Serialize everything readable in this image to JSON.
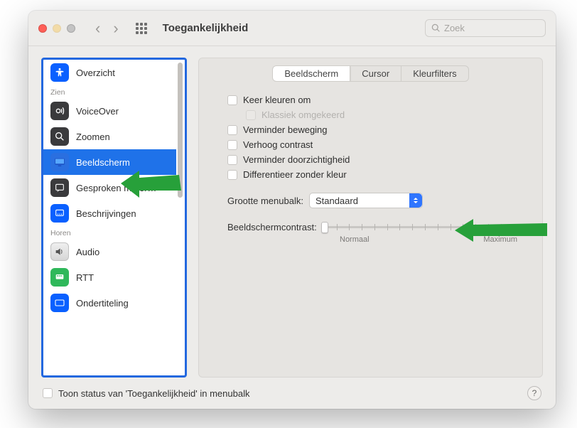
{
  "titlebar": {
    "title": "Toegankelijkheid",
    "search_placeholder": "Zoek"
  },
  "sidebar": {
    "overview_label": "Overzicht",
    "section_zien": "Zien",
    "section_horen": "Horen",
    "items": {
      "voiceover": "VoiceOver",
      "zoomen": "Zoomen",
      "beeldscherm": "Beeldscherm",
      "gesproken": "Gesproken mater…",
      "beschrijvingen": "Beschrijvingen",
      "audio": "Audio",
      "rtt": "RTT",
      "ondertiteling": "Ondertiteling"
    }
  },
  "tabs": {
    "beeldscherm": "Beeldscherm",
    "cursor": "Cursor",
    "kleurfilters": "Kleurfilters"
  },
  "checkboxes": {
    "keer_kleuren": "Keer kleuren om",
    "klassiek": "Klassiek omgekeerd",
    "verminder_beweging": "Verminder beweging",
    "verhoog_contrast": "Verhoog contrast",
    "verminder_doorzichtigheid": "Verminder doorzichtigheid",
    "differentieer": "Differentieer zonder kleur"
  },
  "menubar": {
    "label": "Grootte menubalk:",
    "value": "Standaard"
  },
  "contrast": {
    "label": "Beeldschermcontrast:",
    "min": "Normaal",
    "max": "Maximum"
  },
  "footer": {
    "label": "Toon status van 'Toegankelijkheid' in menubalk"
  }
}
